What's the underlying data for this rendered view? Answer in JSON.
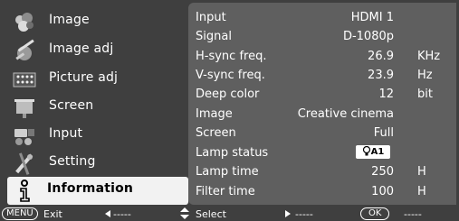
{
  "menu": {
    "items": [
      {
        "label": "Image",
        "icon": "image-icon"
      },
      {
        "label": "Image adj",
        "icon": "image-adjust-icon"
      },
      {
        "label": "Picture adj",
        "icon": "picture-adjust-icon"
      },
      {
        "label": "Screen",
        "icon": "screen-icon"
      },
      {
        "label": "Input",
        "icon": "input-icon"
      },
      {
        "label": "Setting",
        "icon": "setting-icon"
      },
      {
        "label": "Information",
        "icon": "information-icon",
        "active": true
      }
    ]
  },
  "info": {
    "input": {
      "label": "Input",
      "value": "HDMI 1",
      "unit": ""
    },
    "signal": {
      "label": "Signal",
      "value": "D-1080p",
      "unit": ""
    },
    "hsync": {
      "label": "H-sync freq.",
      "value": "26.9",
      "unit": "KHz"
    },
    "vsync": {
      "label": "V-sync freq.",
      "value": "23.9",
      "unit": "Hz"
    },
    "deep_color": {
      "label": "Deep color",
      "value": "12",
      "unit": "bit"
    },
    "image": {
      "label": "Image",
      "value": "Creative cinema",
      "unit": ""
    },
    "screen": {
      "label": "Screen",
      "value": "Full",
      "unit": ""
    },
    "lamp_status": {
      "label": "Lamp status",
      "value": "A1",
      "icon": "lamp-icon"
    },
    "lamp_time": {
      "label": "Lamp time",
      "value": "250",
      "unit": "H"
    },
    "filter_time": {
      "label": "Filter time",
      "value": "100",
      "unit": "H"
    }
  },
  "footer": {
    "menu_key": "MENU",
    "exit_label": "Exit",
    "left_dashes": "-----",
    "select_label": "Select",
    "right_dashes": "-----",
    "ok_key": "OK",
    "ok_dashes": "-----"
  },
  "colors": {
    "background": "#3f3f3f",
    "panel": "#5f5f5f",
    "active_item": "#f2f2f2"
  }
}
